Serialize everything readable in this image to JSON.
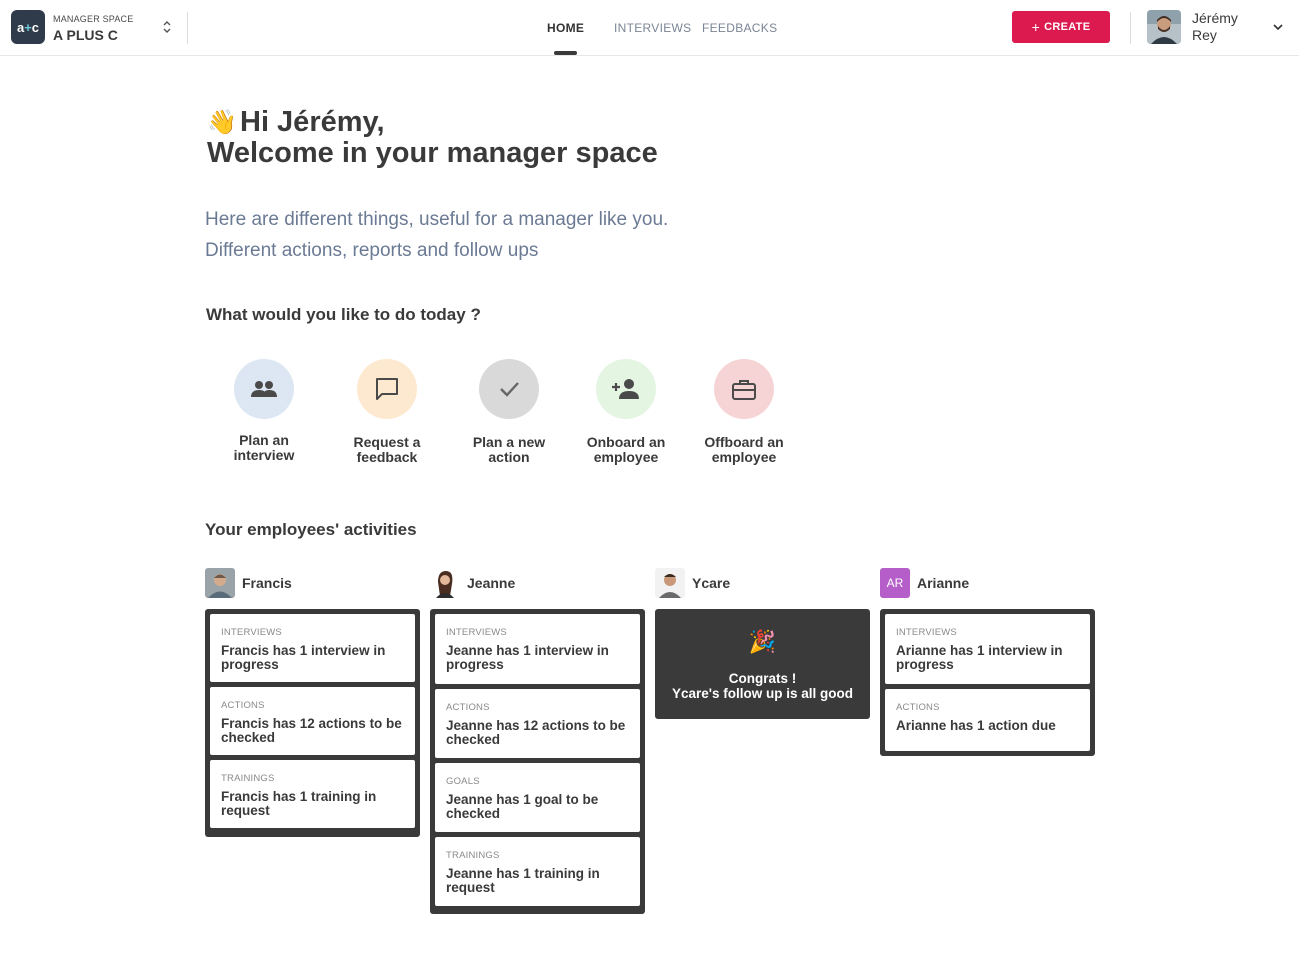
{
  "header": {
    "org_label": "MANAGER SPACE",
    "org_name": "A PLUS C",
    "nav": [
      {
        "label": "HOME",
        "active": true
      },
      {
        "label": "INTERVIEWS",
        "active": false
      },
      {
        "label": "FEEDBACKS",
        "active": false
      }
    ],
    "create_label": "CREATE",
    "user_name": "Jérémy Rey",
    "accent": "#dc1a4f"
  },
  "greeting": {
    "emoji": "👋",
    "line1": "Hi Jérémy,",
    "line2": "Welcome in your manager space"
  },
  "intro": {
    "line1": "Here are different things, useful for a manager like you.",
    "line2": "Different actions, reports and follow ups"
  },
  "quick_actions": {
    "title": "What would you like to do today ?",
    "items": [
      {
        "label": "Plan an interview",
        "icon": "people-icon",
        "color": "#dce7f3"
      },
      {
        "label": "Request a feedback",
        "icon": "chat-icon",
        "color": "#fde9cf"
      },
      {
        "label": "Plan a new action",
        "icon": "check-icon",
        "color": "#d9d9d9"
      },
      {
        "label": "Onboard an employee",
        "icon": "person-add-icon",
        "color": "#e4f5e2"
      },
      {
        "label": "Offboard an employee",
        "icon": "briefcase-icon",
        "color": "#f6d4d6"
      }
    ]
  },
  "activities": {
    "title": "Your employees' activities",
    "employees": [
      {
        "name": "Francis",
        "cards": [
          {
            "category": "INTERVIEWS",
            "text": "Francis has 1 interview in progress"
          },
          {
            "category": "ACTIONS",
            "text": "Francis has 12 actions to be checked"
          },
          {
            "category": "TRAININGS",
            "text": "Francis has 1 training in request"
          }
        ]
      },
      {
        "name": "Jeanne",
        "cards": [
          {
            "category": "INTERVIEWS",
            "text": "Jeanne has 1 interview in progress"
          },
          {
            "category": "ACTIONS",
            "text": "Jeanne has 12 actions to be checked"
          },
          {
            "category": "GOALS",
            "text": "Jeanne has 1 goal to be checked"
          },
          {
            "category": "TRAININGS",
            "text": "Jeanne has 1 training in request"
          }
        ]
      },
      {
        "name": "Ycare",
        "congrats": {
          "emoji": "🎉",
          "line1": "Congrats !",
          "line2": "Ycare's follow up is all good"
        }
      },
      {
        "name": "Arianne",
        "initials": "AR",
        "cards": [
          {
            "category": "INTERVIEWS",
            "text": "Arianne has 1 interview in progress"
          },
          {
            "category": "ACTIONS",
            "text": "Arianne has 1 action due"
          }
        ]
      }
    ]
  }
}
